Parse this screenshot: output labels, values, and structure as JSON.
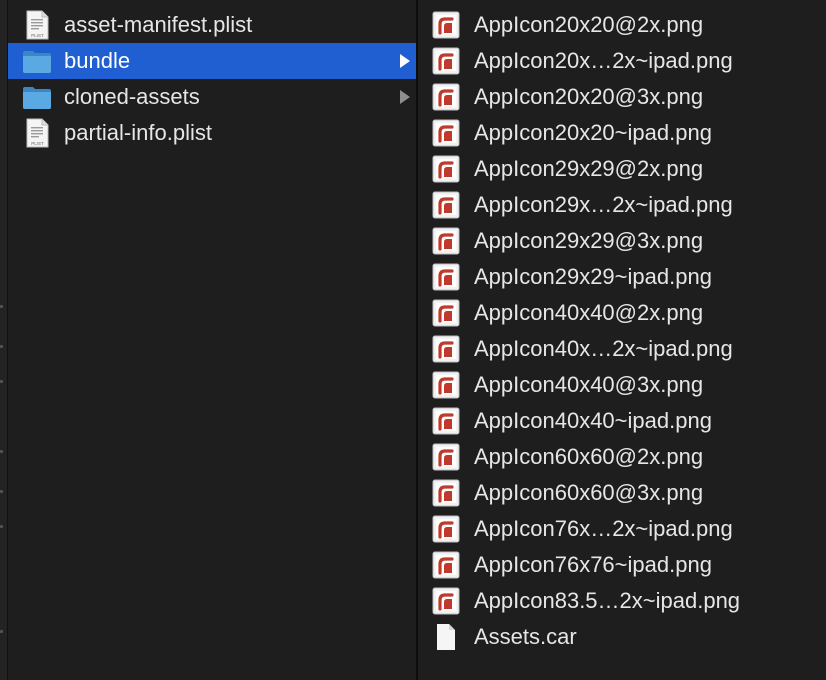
{
  "left_column": {
    "items": [
      {
        "label": "asset-manifest.plist",
        "icon": "plist-file-icon",
        "kind": "file"
      },
      {
        "label": "bundle",
        "icon": "folder-icon",
        "kind": "folder",
        "selected": true
      },
      {
        "label": "cloned-assets",
        "icon": "folder-icon",
        "kind": "folder"
      },
      {
        "label": "partial-info.plist",
        "icon": "plist-file-icon",
        "kind": "file"
      }
    ]
  },
  "plist_badge": "PLIST",
  "right_column": {
    "items": [
      {
        "label": "AppIcon20x20@2x.png",
        "icon": "png-image-icon"
      },
      {
        "label": "AppIcon20x…2x~ipad.png",
        "icon": "png-image-icon"
      },
      {
        "label": "AppIcon20x20@3x.png",
        "icon": "png-image-icon"
      },
      {
        "label": "AppIcon20x20~ipad.png",
        "icon": "png-image-icon"
      },
      {
        "label": "AppIcon29x29@2x.png",
        "icon": "png-image-icon"
      },
      {
        "label": "AppIcon29x…2x~ipad.png",
        "icon": "png-image-icon"
      },
      {
        "label": "AppIcon29x29@3x.png",
        "icon": "png-image-icon"
      },
      {
        "label": "AppIcon29x29~ipad.png",
        "icon": "png-image-icon"
      },
      {
        "label": "AppIcon40x40@2x.png",
        "icon": "png-image-icon"
      },
      {
        "label": "AppIcon40x…2x~ipad.png",
        "icon": "png-image-icon"
      },
      {
        "label": "AppIcon40x40@3x.png",
        "icon": "png-image-icon"
      },
      {
        "label": "AppIcon40x40~ipad.png",
        "icon": "png-image-icon"
      },
      {
        "label": "AppIcon60x60@2x.png",
        "icon": "png-image-icon"
      },
      {
        "label": "AppIcon60x60@3x.png",
        "icon": "png-image-icon"
      },
      {
        "label": "AppIcon76x…2x~ipad.png",
        "icon": "png-image-icon"
      },
      {
        "label": "AppIcon76x76~ipad.png",
        "icon": "png-image-icon"
      },
      {
        "label": "AppIcon83.5…2x~ipad.png",
        "icon": "png-image-icon"
      },
      {
        "label": "Assets.car",
        "icon": "blank-document-icon"
      }
    ]
  },
  "colors": {
    "background": "#1e1e1e",
    "selection": "#1f5fd1",
    "text": "#e6e6e6",
    "folder": "#4a9bd6",
    "png_accent": "#c0392b"
  }
}
